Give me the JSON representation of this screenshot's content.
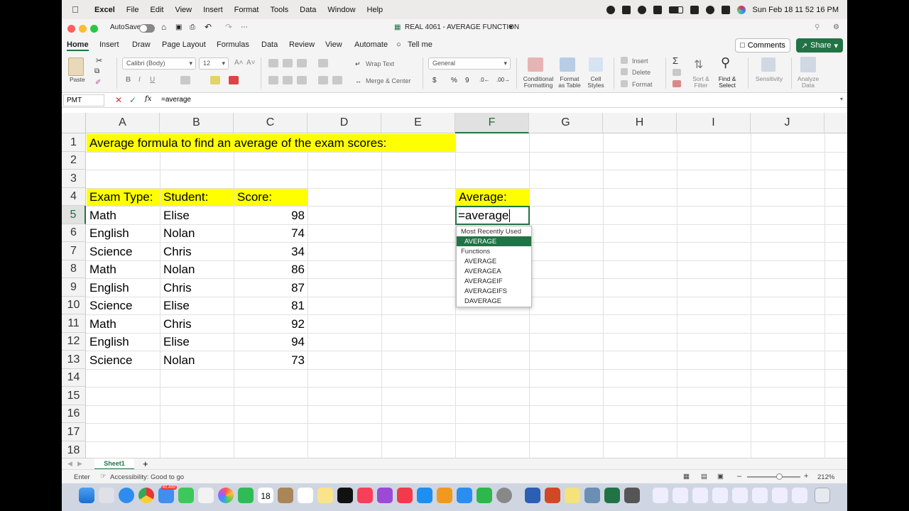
{
  "menubar": {
    "app": "Excel",
    "items": [
      "File",
      "Edit",
      "View",
      "Insert",
      "Format",
      "Tools",
      "Data",
      "Window",
      "Help"
    ],
    "datetime": "Sun Feb 18  11 52 16 PM"
  },
  "titlebar": {
    "autosave_label": "AutoSave",
    "document_title": "REAL 4061 - AVERAGE FUNCTION"
  },
  "tabs": {
    "items": [
      "Home",
      "Insert",
      "Draw",
      "Page Layout",
      "Formulas",
      "Data",
      "Review",
      "View",
      "Automate"
    ],
    "tell_me": "Tell me",
    "comments": "Comments",
    "share": "Share"
  },
  "ribbon": {
    "paste": "Paste",
    "font_name": "Calibri (Body)",
    "font_size": "12",
    "wrap_text": "Wrap Text",
    "merge_center": "Merge & Center",
    "number_format": "General",
    "conditional_formatting": "Conditional Formatting",
    "format_as_table": "Format as Table",
    "cell_styles": "Cell Styles",
    "insert": "Insert",
    "delete": "Delete",
    "format": "Format",
    "sort_filter": "Sort & Filter",
    "find_select": "Find & Select",
    "sensitivity": "Sensitivity",
    "analyze_data": "Analyze Data"
  },
  "formula_bar": {
    "name_box": "PMT",
    "fx": "fx",
    "formula": "=average"
  },
  "grid": {
    "columns": [
      "A",
      "B",
      "C",
      "D",
      "E",
      "F",
      "G",
      "H",
      "I",
      "J"
    ],
    "rows": [
      "1",
      "2",
      "3",
      "4",
      "5",
      "6",
      "7",
      "8",
      "9",
      "10",
      "11",
      "12",
      "13",
      "14",
      "15",
      "16",
      "17",
      "18"
    ],
    "title": "Average formula to find an average of the exam scores:",
    "headers": {
      "exam_type": "Exam Type:",
      "student": "Student:",
      "score": "Score:",
      "average": "Average:"
    },
    "data": [
      {
        "exam": "Math",
        "student": "Elise",
        "score": "98"
      },
      {
        "exam": "English",
        "student": "Nolan",
        "score": "74"
      },
      {
        "exam": "Science",
        "student": "Chris",
        "score": "34"
      },
      {
        "exam": "Math",
        "student": "Nolan",
        "score": "86"
      },
      {
        "exam": "English",
        "student": "Chris",
        "score": "87"
      },
      {
        "exam": "Science",
        "student": "Elise",
        "score": "81"
      },
      {
        "exam": "Math",
        "student": "Chris",
        "score": "92"
      },
      {
        "exam": "English",
        "student": "Elise",
        "score": "94"
      },
      {
        "exam": "Science",
        "student": "Nolan",
        "score": "73"
      }
    ],
    "active_cell_value": "=average"
  },
  "autocomplete": {
    "recent_header": "Most Recently Used",
    "recent": [
      "AVERAGE"
    ],
    "functions_header": "Functions",
    "functions": [
      "AVERAGE",
      "AVERAGEA",
      "AVERAGEIF",
      "AVERAGEIFS",
      "DAVERAGE"
    ]
  },
  "sheets": {
    "active": "Sheet1",
    "add": "+"
  },
  "statusbar": {
    "mode": "Enter",
    "accessibility": "Accessibility: Good to go",
    "zoom": "212%"
  },
  "dock": {
    "mail_badge": "40,499",
    "calendar_day": "18"
  },
  "colors": {
    "accent": "#217346",
    "highlight": "#ffff00"
  }
}
